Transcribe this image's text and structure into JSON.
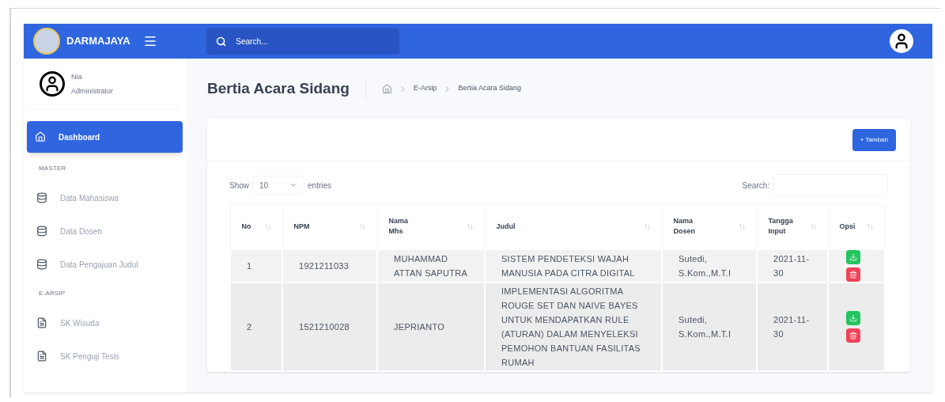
{
  "header": {
    "brand": "DARMAJAYA",
    "search_placeholder": "Search..."
  },
  "user": {
    "name": "Nia",
    "role": "Administrator"
  },
  "sidebar": {
    "sections": [
      {
        "items": [
          {
            "label": "Dashboard",
            "selected": true
          }
        ]
      },
      {
        "heading": "MASTER",
        "items": [
          {
            "label": "Data Mahasiswa",
            "selected": false
          },
          {
            "label": "Data Dosen",
            "selected": false
          },
          {
            "label": "Data Pengajuan Judul",
            "selected": false
          }
        ]
      },
      {
        "heading": "E-ARSIP",
        "items": [
          {
            "label": "SK Wisuda",
            "selected": false
          },
          {
            "label": "SK Penguji Tesis",
            "selected": false
          }
        ]
      }
    ]
  },
  "page": {
    "title": "Bertia Acara Sidang",
    "breadcrumb": [
      "E-Arsip",
      "Bertia Acara Sidang"
    ]
  },
  "card": {
    "add_button": "+ Tambah",
    "show_label": "Show",
    "entries_value": "10",
    "entries_label": "entries",
    "search_label": "Search:"
  },
  "table": {
    "columns": [
      "No",
      "NPM",
      "Nama Mhs",
      "Judul",
      "Nama Dosen",
      "Tangga Input",
      "Opsi"
    ],
    "rows": [
      {
        "cells": [
          "1",
          "1921211033",
          "MUHAMMAD ATTAN SAPUTRA",
          "SISTEM PENDETEKSI WAJAH MANUSIA PADA CITRA DIGITAL",
          "Sutedi, S.Kom.,M.T.I",
          "2021-11-30"
        ]
      },
      {
        "cells": [
          "2",
          "1521210028",
          "JEPRIANTO",
          "IMPLEMENTASI ALGORITMA ROUGE SET DAN NAIVE BAYES UNTUK MENDAPATKAN RULE (ATURAN) DALAM MENYELEKSI PEMOHON BANTUAN FASILITAS RUMAH",
          "Sutedi, S.Kom.,M.T.I",
          "2021-11-30"
        ]
      }
    ]
  }
}
